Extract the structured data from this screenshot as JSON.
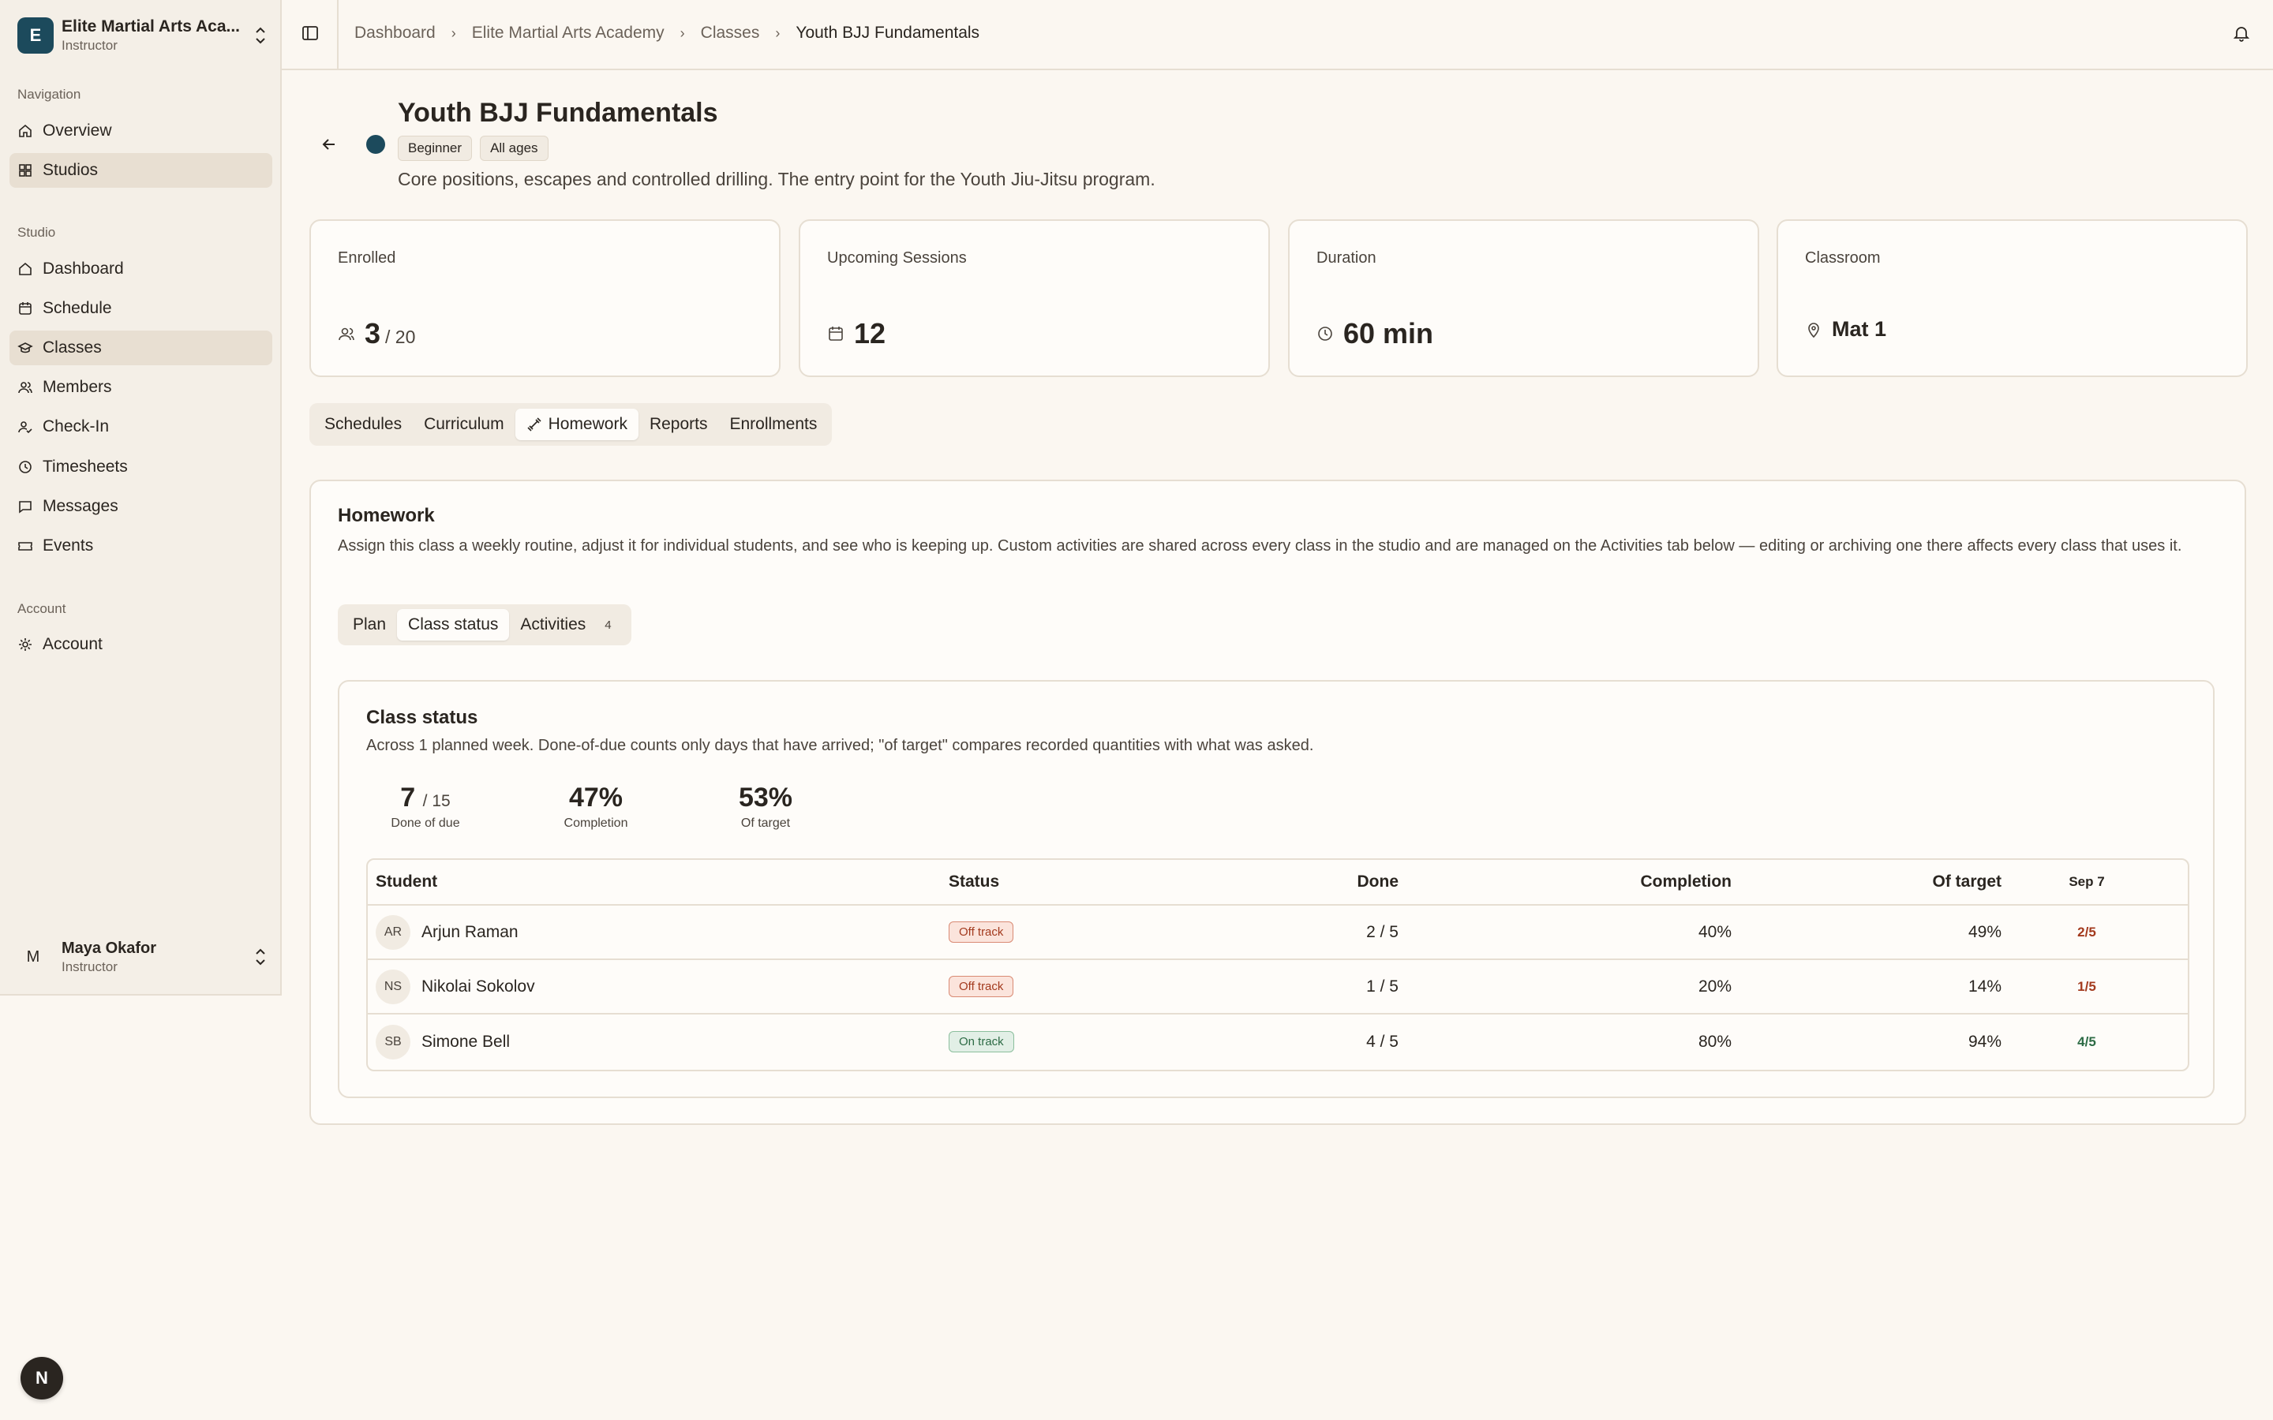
{
  "sidebar": {
    "org_initial": "E",
    "org_name": "Elite Martial Arts Aca...",
    "org_role": "Instructor",
    "sections": {
      "navigation": "Navigation",
      "studio": "Studio",
      "account": "Account"
    },
    "nav_items": [
      {
        "label": "Overview",
        "icon": "home-icon"
      },
      {
        "label": "Studios",
        "icon": "grid-icon",
        "active": true
      }
    ],
    "studio_items": [
      {
        "label": "Dashboard",
        "icon": "dashboard-icon"
      },
      {
        "label": "Schedule",
        "icon": "calendar-icon"
      },
      {
        "label": "Classes",
        "icon": "graduation-cap-icon",
        "active": true
      },
      {
        "label": "Members",
        "icon": "users-icon"
      },
      {
        "label": "Check-In",
        "icon": "user-check-icon"
      },
      {
        "label": "Timesheets",
        "icon": "clock-icon"
      },
      {
        "label": "Messages",
        "icon": "message-icon"
      },
      {
        "label": "Events",
        "icon": "ticket-icon"
      }
    ],
    "account_items": [
      {
        "label": "Account",
        "icon": "gear-icon"
      }
    ],
    "user": {
      "initial": "M",
      "name": "Maya Okafor",
      "role": "Instructor"
    },
    "floating_badge": "N"
  },
  "header": {
    "breadcrumb": [
      "Dashboard",
      "Elite Martial Arts Academy",
      "Classes",
      "Youth BJJ Fundamentals"
    ]
  },
  "class": {
    "title": "Youth BJJ Fundamentals",
    "chips": [
      "Beginner",
      "All ages"
    ],
    "description": "Core positions, escapes and controlled drilling. The entry point for the Youth Jiu-Jitsu program.",
    "color": "#1c4a5c"
  },
  "stats": {
    "enrolled": {
      "label": "Enrolled",
      "value": "3",
      "capacity": "/ 20"
    },
    "sessions": {
      "label": "Upcoming Sessions",
      "value": "12"
    },
    "duration": {
      "label": "Duration",
      "value": "60 min"
    },
    "classroom": {
      "label": "Classroom",
      "value": "Mat 1"
    }
  },
  "tabs": [
    "Schedules",
    "Curriculum",
    "Homework",
    "Reports",
    "Enrollments"
  ],
  "homework": {
    "title": "Homework",
    "description": "Assign this class a weekly routine, adjust it for individual students, and see who is keeping up. Custom activities are shared across every class in the studio and are managed on the Activities tab below — editing or archiving one there affects every class that uses it.",
    "subtabs": [
      "Plan",
      "Class status",
      "Activities"
    ],
    "activities_count": "4",
    "status": {
      "title": "Class status",
      "description": "Across 1 planned week. Done-of-due counts only days that have arrived; \"of target\" compares recorded quantities with what was asked.",
      "kpis": [
        {
          "value": "7",
          "sub": "/ 15",
          "label": "Done of due"
        },
        {
          "value": "47%",
          "sub": "",
          "label": "Completion"
        },
        {
          "value": "53%",
          "sub": "",
          "label": "Of target"
        }
      ],
      "columns": {
        "student": "Student",
        "status": "Status",
        "done": "Done",
        "completion": "Completion",
        "target": "Of target",
        "day": "Sep 7"
      },
      "rows": [
        {
          "initials": "AR",
          "name": "Arjun Raman",
          "status": "Off track",
          "done": "2 / 5",
          "completion": "40%",
          "target": "49%",
          "day": "2/5"
        },
        {
          "initials": "NS",
          "name": "Nikolai Sokolov",
          "status": "Off track",
          "done": "1 / 5",
          "completion": "20%",
          "target": "14%",
          "day": "1/5"
        },
        {
          "initials": "SB",
          "name": "Simone Bell",
          "status": "On track",
          "done": "4 / 5",
          "completion": "80%",
          "target": "94%",
          "day": "4/5"
        }
      ]
    }
  }
}
